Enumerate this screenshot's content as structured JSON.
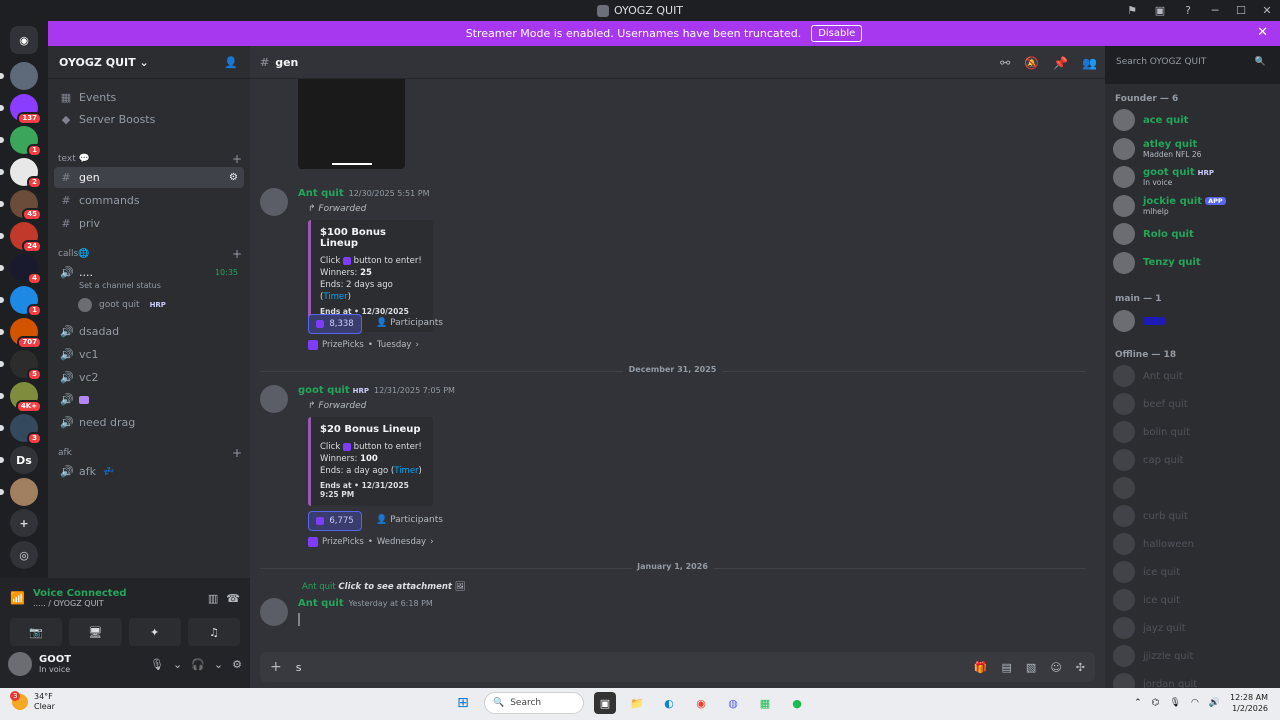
{
  "window": {
    "title": "OYOGZ QUIT"
  },
  "banner": {
    "text": "Streamer Mode is enabled. Usernames have been truncated.",
    "button": "Disable"
  },
  "guilds": [
    {
      "badge": "",
      "color": "#5e6a7a"
    },
    {
      "badge": "137",
      "color": "#8b3dff"
    },
    {
      "badge": "1",
      "color": "#3ba55c"
    },
    {
      "badge": "2",
      "color": "#e8e8e8"
    },
    {
      "badge": "45",
      "color": "#6b4c3b"
    },
    {
      "badge": "24",
      "color": "#c0392b"
    },
    {
      "badge": "4",
      "color": "#1a1a2e"
    },
    {
      "badge": "1",
      "color": "#1e88e5"
    },
    {
      "badge": "707",
      "color": "#d35400"
    },
    {
      "badge": "5",
      "color": "#2c2c2c"
    },
    {
      "badge": "4K+",
      "color": "#7f8c3d"
    },
    {
      "badge": "3",
      "color": "#34495e"
    },
    {
      "badge": "",
      "color": "#313338",
      "label": "Ds"
    },
    {
      "badge": "",
      "color": "#a08060"
    }
  ],
  "server": {
    "name": "OYOGZ QUIT",
    "top_items": [
      "Events",
      "Server Boosts"
    ],
    "categories": {
      "text": "text 💬",
      "calls": "calls🌐",
      "afk": "afk"
    },
    "text_channels": [
      "gen",
      "commands",
      "priv"
    ],
    "voice": {
      "active_name": "....",
      "active_time": "10:35",
      "status_prompt": "Set a channel status",
      "member": "goot quit",
      "member_tag": "HRP",
      "channels": [
        "dsadad",
        "vc1",
        "vc2",
        "",
        "need drag"
      ]
    },
    "afk_channel": "afk"
  },
  "voice_panel": {
    "status": "Voice Connected",
    "location": "..... / OYOGZ QUIT"
  },
  "me": {
    "name": "GOOT",
    "status": "In voice"
  },
  "chat": {
    "channel": "gen",
    "search_placeholder": "Search OYOGZ QUIT",
    "messages": [
      {
        "author": "Ant quit",
        "time": "12/30/2025 5:51 PM",
        "forwarded": "Forwarded",
        "embed_title": "$100 Bonus Lineup",
        "click": "Click",
        "click_rest": "button to enter!",
        "winners_label": "Winners:",
        "winners": "25",
        "ends_label": "Ends:",
        "ends": "2 days ago",
        "timer": "Timer",
        "ends_at": "Ends at • 12/30/2025 8:51 PM",
        "reactions": "8,338",
        "participants": "Participants",
        "app": "PrizePicks",
        "app_day": "Tuesday"
      },
      {
        "author": "goot quit",
        "tag": "HRP",
        "time": "12/31/2025 7:05 PM",
        "forwarded": "Forwarded",
        "embed_title": "$20 Bonus Lineup",
        "click": "Click",
        "click_rest": "button to enter!",
        "winners_label": "Winners:",
        "winners": "100",
        "ends_label": "Ends:",
        "ends": "a day ago",
        "timer": "Timer",
        "ends_at": "Ends at • 12/31/2025 9:25 PM",
        "reactions": "6,775",
        "participants": "Participants",
        "app": "PrizePicks",
        "app_day": "Wednesday"
      }
    ],
    "dividers": [
      "December 31, 2025",
      "January 1, 2026"
    ],
    "reply": {
      "author": "Ant quit",
      "text": "Click to see attachment"
    },
    "last": {
      "author": "Ant quit",
      "time": "Yesterday at 6:18 PM"
    },
    "composer_text": "s"
  },
  "members": {
    "founder_header": "Founder — 6",
    "founders": [
      {
        "name": "ace quit",
        "sub": "",
        "tag": ""
      },
      {
        "name": "atley quit",
        "sub": "Madden NFL 26",
        "tag": ""
      },
      {
        "name": "goot quit",
        "sub": "In voice",
        "tag": "HRP"
      },
      {
        "name": "jockie quit",
        "sub": "mlhelp",
        "tag": "APP"
      },
      {
        "name": "Rolo quit",
        "sub": "",
        "tag": ""
      },
      {
        "name": "Tenzy quit",
        "sub": "",
        "tag": ""
      }
    ],
    "main_header": "main — 1",
    "offline_header": "Offline — 18",
    "offline": [
      "Ant quit",
      "beef quit",
      "bolin quit",
      "cap quit",
      "",
      "curb quit",
      "halloween",
      "ice quit",
      "ice quit",
      "jayz quit",
      "jjizzle quit",
      "jordan quit"
    ]
  },
  "taskbar": {
    "temp": "34°F",
    "weather": "Clear",
    "search": "Search",
    "time": "12:28 AM",
    "date": "1/2/2026",
    "notif": "3"
  }
}
